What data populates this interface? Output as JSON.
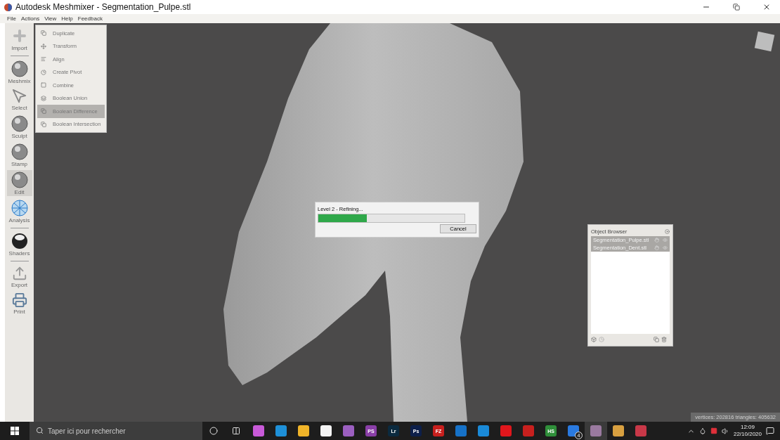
{
  "window": {
    "title": "Autodesk Meshmixer - Segmentation_Pulpe.stl"
  },
  "menu_bar": [
    "File",
    "Actions",
    "View",
    "Help",
    "Feedback"
  ],
  "toolbar": [
    {
      "label": "Import",
      "selected": false
    },
    {
      "label": "Meshmix",
      "selected": false
    },
    {
      "label": "Select",
      "selected": false
    },
    {
      "label": "Sculpt",
      "selected": false
    },
    {
      "label": "Stamp",
      "selected": false
    },
    {
      "label": "Edit",
      "selected": true
    },
    {
      "label": "Analysis",
      "selected": false
    },
    {
      "label": "Shaders",
      "selected": false
    },
    {
      "label": "Export",
      "selected": false
    },
    {
      "label": "Print",
      "selected": false
    }
  ],
  "edit_menu": [
    {
      "label": "Duplicate",
      "selected": false
    },
    {
      "label": "Transform",
      "selected": false
    },
    {
      "label": "Align",
      "selected": false
    },
    {
      "label": "Create Pivot",
      "selected": false
    },
    {
      "label": "Combine",
      "selected": false
    },
    {
      "label": "Boolean Union",
      "selected": false
    },
    {
      "label": "Boolean Difference",
      "selected": true
    },
    {
      "label": "Boolean Intersection",
      "selected": false
    }
  ],
  "progress_dialog": {
    "message": "Level 2 - Refining...",
    "level": 0.33,
    "button": "Cancel"
  },
  "object_browser": {
    "title": "Object Browser",
    "items": [
      {
        "name": "Segmentation_Pulpe.stl",
        "selected": true
      },
      {
        "name": "Segmentation_Dent.stl",
        "selected": true
      }
    ]
  },
  "status": "vertices: 202816 triangles: 405632",
  "taskbar": {
    "search": {
      "placeholder": "Taper ici pour rechercher"
    },
    "apps": [
      {
        "color": "#c85ad8",
        "active": false
      },
      {
        "color": "#1e90d8",
        "active": false
      },
      {
        "color": "#f0b429",
        "active": false
      },
      {
        "color": "#f4f4f4",
        "active": false
      },
      {
        "color": "#9b5fc0",
        "active": false
      },
      {
        "color": "#8a3fa8",
        "label": "PS",
        "active": false
      },
      {
        "color": "#0b2a3f",
        "label": "Lr",
        "active": false
      },
      {
        "color": "#0d1f4a",
        "label": "Ps",
        "active": false
      },
      {
        "color": "#c8201e",
        "label": "FZ",
        "active": false
      },
      {
        "color": "#1672c8",
        "active": false
      },
      {
        "color": "#1a8ad8",
        "active": false
      },
      {
        "color": "#e0161c",
        "active": false
      },
      {
        "color": "#c8201e",
        "active": false
      },
      {
        "color": "#2f8f3a",
        "label": "HS",
        "active": false
      },
      {
        "color": "#2a7ae0",
        "badge": "4",
        "active": false
      },
      {
        "color": "#9a7aa0",
        "active": true
      },
      {
        "color": "#d8a040",
        "active": false
      },
      {
        "color": "#c83848",
        "active": false
      }
    ],
    "time": "12:09",
    "date": "22/10/2020"
  }
}
